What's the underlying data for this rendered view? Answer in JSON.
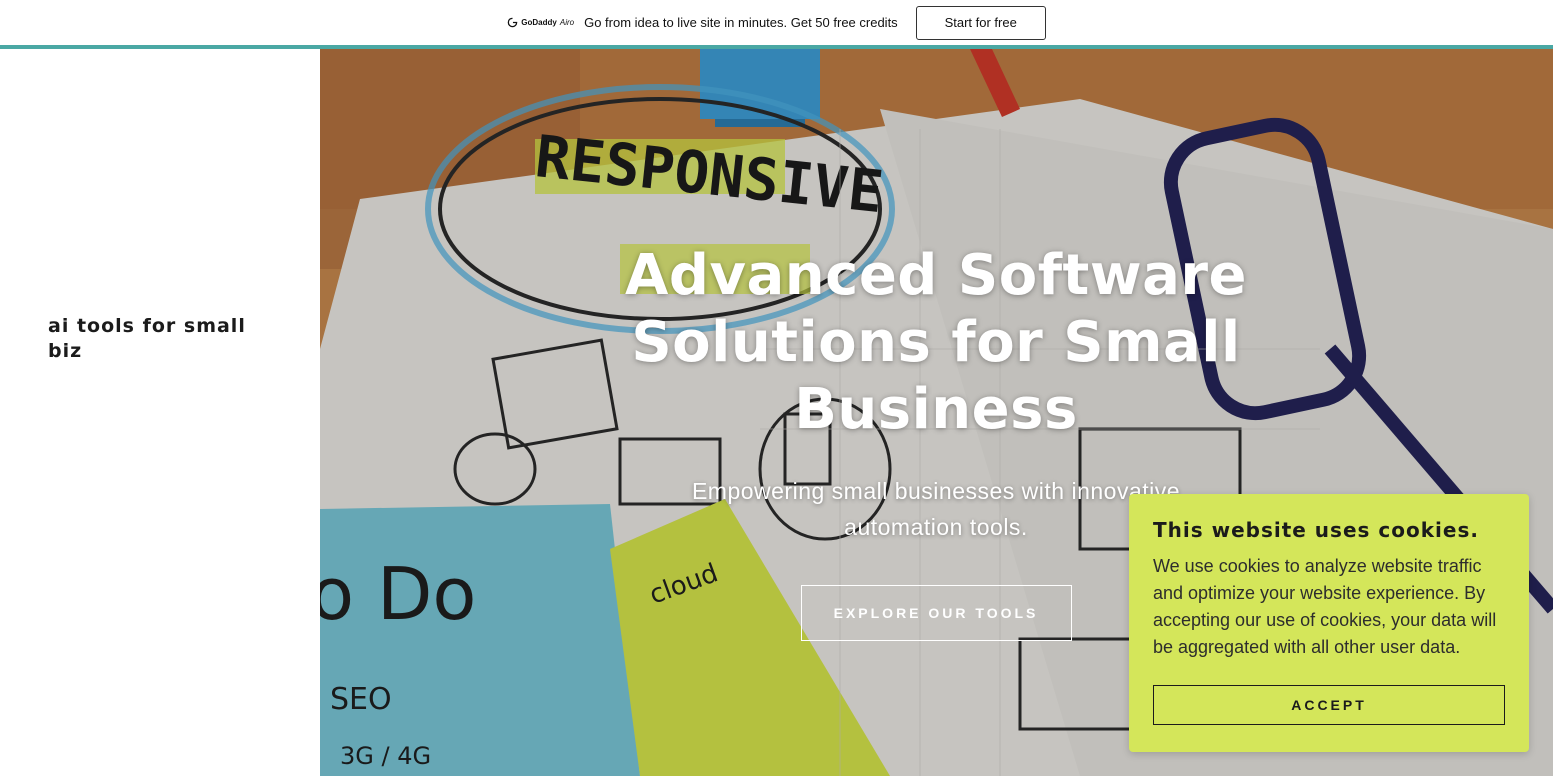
{
  "promo": {
    "logo_text": "GoDaddy",
    "logo_suffix": "Airo",
    "message": "Go from idea to live site in minutes. Get 50 free credits",
    "cta_label": "Start for free"
  },
  "sidebar": {
    "site_title": "ai tools for small biz"
  },
  "hero": {
    "title": "Advanced Software Solutions for Small Business",
    "subtitle": "Empowering small businesses with innovative automation tools.",
    "cta_label": "EXPLORE OUR TOOLS"
  },
  "cookie": {
    "title": "This website uses cookies.",
    "body": "We use cookies to analyze website traffic and optimize your website experience. By accepting our use of cookies, your data will be aggregated with all other user data.",
    "accept_label": "ACCEPT"
  },
  "colors": {
    "accent_bar": "#4aa8a4",
    "cookie_background": "#d4e65a"
  },
  "icons": {
    "promo_logo": "godaddy-logo-icon"
  }
}
